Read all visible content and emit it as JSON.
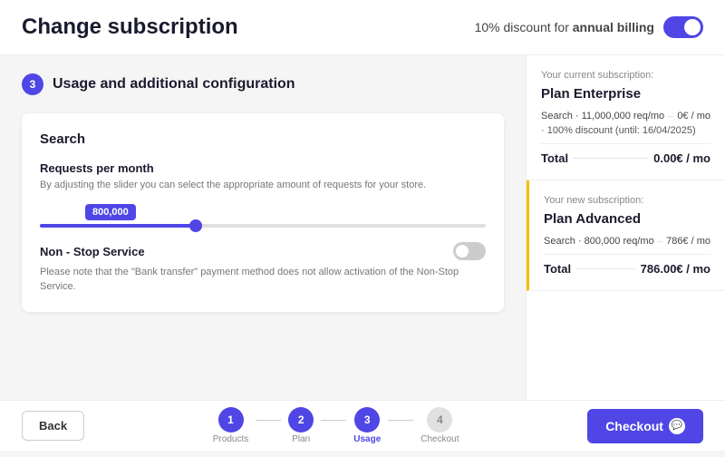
{
  "header": {
    "title": "Change subscription",
    "billing_label": "10% discount for",
    "billing_highlight": "annual billing",
    "toggle_on": true
  },
  "step": {
    "number": "3",
    "title": "Usage and additional configuration"
  },
  "search_config": {
    "section_title": "Search",
    "rpm_label": "Requests per month",
    "rpm_desc": "By adjusting the slider you can select the appropriate amount of requests for your store.",
    "slider_value": "800,000",
    "nss_label": "Non - Stop Service",
    "nss_desc": "Please note that the \"Bank transfer\" payment method does not allow activation of the Non-Stop Service."
  },
  "current_subscription": {
    "label": "Your current subscription:",
    "plan_name": "Plan Enterprise",
    "search_label": "Search · 11,000,000 req/mo",
    "search_price": "0€ / mo",
    "discount_line": "· 100% discount (until: 16/04/2025)",
    "total_label": "Total",
    "total_price": "0.00€ / mo"
  },
  "new_subscription": {
    "label": "Your new subscription:",
    "plan_name": "Plan Advanced",
    "search_label": "Search · 800,000 req/mo",
    "search_price": "786€ / mo",
    "total_label": "Total",
    "total_price": "786.00€ / mo"
  },
  "footer": {
    "back_label": "Back",
    "checkout_label": "Checkout",
    "steps": [
      {
        "number": "1",
        "name": "Products",
        "state": "done"
      },
      {
        "number": "2",
        "name": "Plan",
        "state": "done"
      },
      {
        "number": "3",
        "name": "Usage",
        "state": "active"
      },
      {
        "number": "4",
        "name": "Checkout",
        "state": "inactive"
      }
    ]
  }
}
